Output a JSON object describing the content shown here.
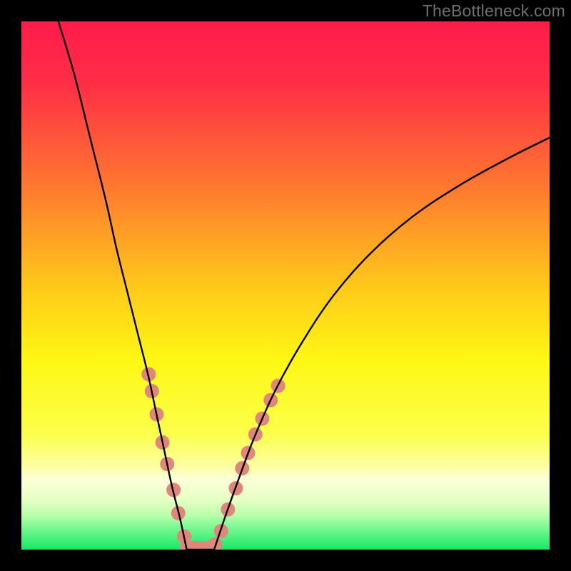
{
  "watermark": "TheBottleneck.com",
  "chart_data": {
    "type": "line",
    "title": "",
    "xlabel": "",
    "ylabel": "",
    "xlim": [
      0,
      100
    ],
    "ylim": [
      0,
      100
    ],
    "gradient_stops": [
      {
        "offset": 0.0,
        "color": "#ff1b4b"
      },
      {
        "offset": 0.12,
        "color": "#ff2f46"
      },
      {
        "offset": 0.3,
        "color": "#ff7331"
      },
      {
        "offset": 0.5,
        "color": "#ffc81a"
      },
      {
        "offset": 0.64,
        "color": "#fff714"
      },
      {
        "offset": 0.78,
        "color": "#fbff4a"
      },
      {
        "offset": 0.845,
        "color": "#fcffa6"
      },
      {
        "offset": 0.865,
        "color": "#fdffd8"
      },
      {
        "offset": 0.905,
        "color": "#e6ffc5"
      },
      {
        "offset": 0.935,
        "color": "#b9ffab"
      },
      {
        "offset": 0.965,
        "color": "#69f68b"
      },
      {
        "offset": 1.0,
        "color": "#17e765"
      }
    ],
    "series": [
      {
        "name": "curve-left",
        "x": [
          7,
          10,
          13,
          16,
          18,
          20,
          22,
          24,
          25.5,
          27,
          28.5,
          30,
          31.3
        ],
        "y": [
          100,
          90,
          78,
          66,
          57,
          49,
          41,
          33,
          26,
          19,
          12,
          6,
          0
        ]
      },
      {
        "name": "curve-floor",
        "x": [
          31.3,
          33,
          35,
          36.5
        ],
        "y": [
          0,
          0,
          0,
          0
        ]
      },
      {
        "name": "curve-right",
        "x": [
          36.5,
          38.5,
          41,
          44,
          48,
          53,
          59,
          66,
          74,
          83,
          92,
          100
        ],
        "y": [
          0,
          6,
          13,
          21,
          30,
          39,
          48,
          56,
          63,
          69,
          74,
          78
        ]
      }
    ],
    "markers": {
      "color": "#e0877c",
      "radius_px": 10,
      "points": [
        {
          "x": 24.1,
          "y": 33.2
        },
        {
          "x": 24.7,
          "y": 30.0
        },
        {
          "x": 25.6,
          "y": 25.6
        },
        {
          "x": 26.7,
          "y": 20.3
        },
        {
          "x": 27.6,
          "y": 16.2
        },
        {
          "x": 28.8,
          "y": 11.3
        },
        {
          "x": 29.7,
          "y": 6.9
        },
        {
          "x": 30.8,
          "y": 2.5
        },
        {
          "x": 31.4,
          "y": 0.6
        },
        {
          "x": 32.8,
          "y": 0.3
        },
        {
          "x": 34.3,
          "y": 0.3
        },
        {
          "x": 35.6,
          "y": 0.3
        },
        {
          "x": 36.7,
          "y": 1.0
        },
        {
          "x": 37.8,
          "y": 3.5
        },
        {
          "x": 39.1,
          "y": 7.6
        },
        {
          "x": 40.6,
          "y": 11.6
        },
        {
          "x": 41.8,
          "y": 15.4
        },
        {
          "x": 42.9,
          "y": 18.3
        },
        {
          "x": 44.3,
          "y": 21.8
        },
        {
          "x": 45.6,
          "y": 24.8
        },
        {
          "x": 47.2,
          "y": 28.3
        },
        {
          "x": 48.6,
          "y": 31.0
        }
      ]
    }
  }
}
